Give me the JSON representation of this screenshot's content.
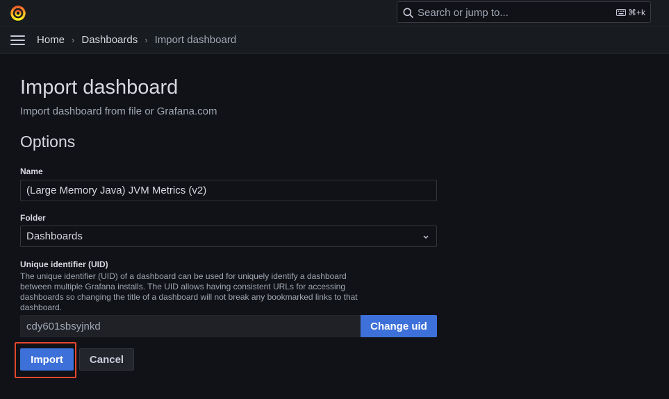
{
  "topbar": {
    "search_placeholder": "Search or jump to...",
    "shortcut": "⌘+k"
  },
  "breadcrumb": {
    "items": [
      "Home",
      "Dashboards",
      "Import dashboard"
    ]
  },
  "page": {
    "title": "Import dashboard",
    "subtitle": "Import dashboard from file or Grafana.com",
    "section_title": "Options"
  },
  "form": {
    "name_label": "Name",
    "name_value": "(Large Memory Java) JVM Metrics (v2)",
    "folder_label": "Folder",
    "folder_value": "Dashboards",
    "uid_label": "Unique identifier (UID)",
    "uid_description": "The unique identifier (UID) of a dashboard can be used for uniquely identify a dashboard between multiple Grafana installs. The UID allows having consistent URLs for accessing dashboards so changing the title of a dashboard will not break any bookmarked links to that dashboard.",
    "uid_value": "cdy601sbsyjnkd",
    "change_uid_label": "Change uid",
    "import_label": "Import",
    "cancel_label": "Cancel"
  },
  "colors": {
    "background": "#111217",
    "primary_button": "#3d71d9",
    "highlight_border": "#e4472d",
    "logo_orange": "#f46800"
  }
}
